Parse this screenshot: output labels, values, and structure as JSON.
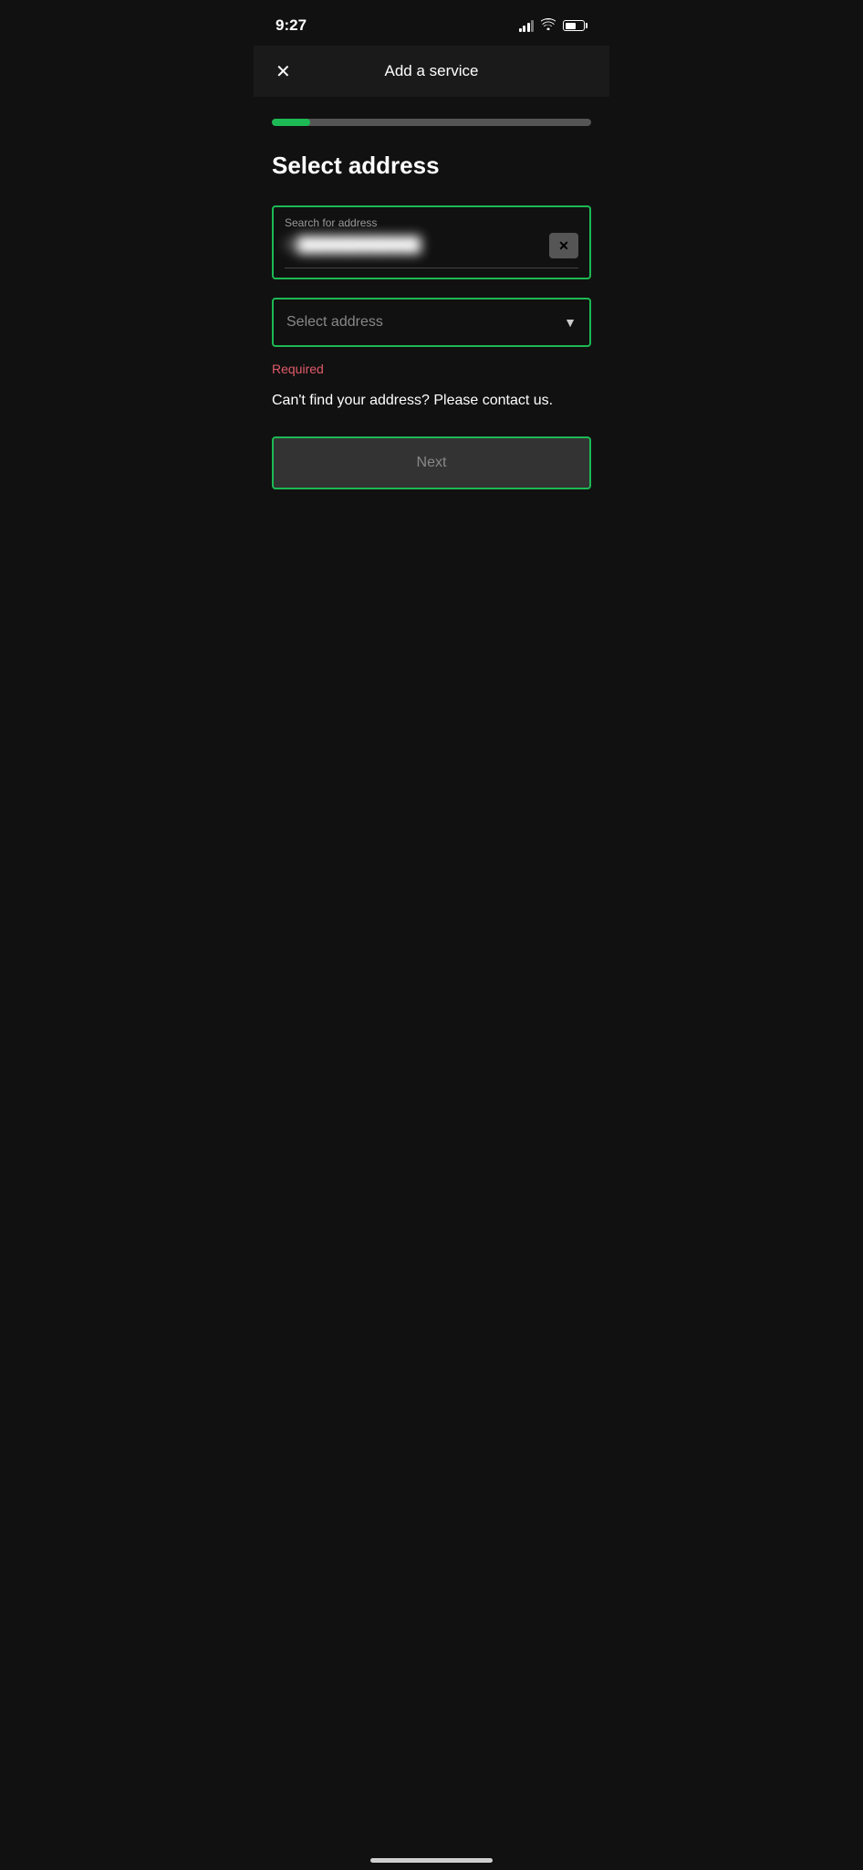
{
  "statusBar": {
    "time": "9:27",
    "signal": "signal-icon",
    "wifi": "wifi-icon",
    "battery": "battery-icon"
  },
  "header": {
    "title": "Add a service",
    "closeLabel": "×"
  },
  "progress": {
    "percentage": 12,
    "totalWidth": 100
  },
  "page": {
    "sectionTitle": "Select address",
    "searchLabel": "Search for address",
    "searchValue": "3",
    "clearButton": "✕",
    "selectPlaceholder": "Select address",
    "requiredText": "Required",
    "contactText": "Can't find your address? Please contact us.",
    "nextButton": "Next"
  }
}
